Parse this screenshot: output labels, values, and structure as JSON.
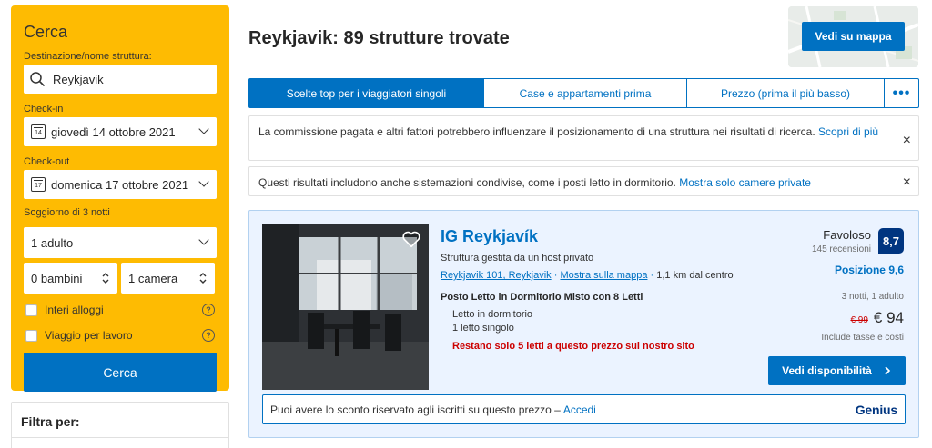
{
  "search": {
    "title": "Cerca",
    "destination_label": "Destinazione/nome struttura:",
    "destination_value": "Reykjavik",
    "checkin_label": "Check-in",
    "checkin_value": "giovedì 14 ottobre 2021",
    "checkin_day": "14",
    "checkout_label": "Check-out",
    "checkout_value": "domenica 17 ottobre 2021",
    "checkout_day": "17",
    "stay_label": "Soggiorno di 3 notti",
    "adults": "1 adulto",
    "children": "0 bambini",
    "rooms": "1 camera",
    "whole_homes": "Interi alloggi",
    "work_trip": "Viaggio per lavoro",
    "search_button": "Cerca"
  },
  "filters": {
    "title": "Filtra per:"
  },
  "results": {
    "title": "Reykjavik: 89 strutture trovate",
    "map_button": "Vedi su mappa"
  },
  "tabs": [
    {
      "label": "Scelte top per i viaggiatori singoli"
    },
    {
      "label": "Case e appartamenti prima"
    },
    {
      "label": "Prezzo (prima il più basso)"
    }
  ],
  "tabs_more": "•••",
  "notices": {
    "commission_text": "La commissione pagata e altri fattori potrebbero influenzare il posizionamento di una struttura nei risultati di ricerca.",
    "commission_link": "Scopri di più",
    "shared_text": "Questi risultati includono anche sistemazioni condivise, come i posti letto in dormitorio.",
    "shared_link": "Mostra solo camere private",
    "close": "×"
  },
  "property": {
    "name": "IG Reykjavík",
    "host": "Struttura gestita da un host privato",
    "area_link": "Reykjavik 101, Reykjavik",
    "map_link": "Mostra sulla mappa",
    "distance": "1,1 km dal centro",
    "room_name": "Posto Letto in Dormitorio Misto con 8 Letti",
    "room_type": "Letto in dormitorio",
    "beds": "1 letto singolo",
    "scarcity": "Restano solo 5 letti a questo prezzo sul nostro sito",
    "score_word": "Favoloso",
    "reviews": "145 recensioni",
    "score": "8,7",
    "position": "Posizione 9,6",
    "nights_guests": "3 notti, 1 adulto",
    "old_price": "€ 99",
    "new_price": "€ 94",
    "taxes": "Include tasse e costi",
    "availability_button": "Vedi disponibilità",
    "genius_text": "Puoi avere lo sconto riservato agli iscritti su questo prezzo –",
    "genius_link": "Accedi",
    "genius_logo": "Genius"
  },
  "colors": {
    "brand_blue": "#0071c2",
    "dark_blue": "#003580",
    "search_yellow": "#febb02",
    "alert_red": "#cc0000"
  }
}
